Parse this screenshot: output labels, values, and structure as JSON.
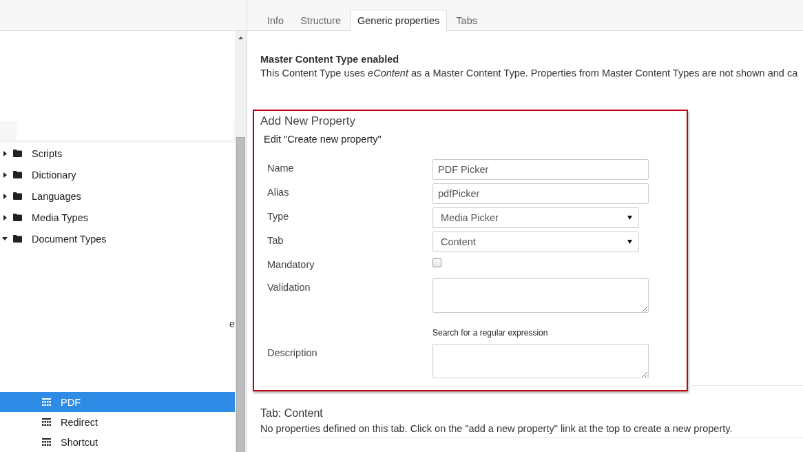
{
  "sidebar": {
    "tree": [
      {
        "label": "Scripts",
        "expanded": false,
        "selected": false
      },
      {
        "label": "Dictionary",
        "expanded": false,
        "selected": false
      },
      {
        "label": "Languages",
        "expanded": false,
        "selected": false
      },
      {
        "label": "Media Types",
        "expanded": false,
        "selected": false
      },
      {
        "label": "Document Types",
        "expanded": true,
        "selected": false,
        "children": [
          {
            "label": "PDF",
            "selected": true
          },
          {
            "label": "Redirect",
            "selected": false
          },
          {
            "label": "Shortcut",
            "selected": false
          }
        ]
      }
    ],
    "partial_label": "e"
  },
  "tabs": [
    {
      "label": "Info",
      "selected": false
    },
    {
      "label": "Structure",
      "selected": false
    },
    {
      "label": "Generic properties",
      "selected": true
    },
    {
      "label": "Tabs",
      "selected": false
    }
  ],
  "notice": {
    "title": "Master Content Type enabled",
    "text": "This Content Type uses *eContent* as a Master Content Type. Properties from Master Content Types are not shown and ca"
  },
  "add_property": {
    "title": "Add New Property",
    "subtitle": "Edit \"Create new property\"",
    "fields": [
      {
        "label": "Name",
        "kind": "text",
        "value": "PDF Picker"
      },
      {
        "label": "Alias",
        "kind": "text",
        "value": "pdfPicker"
      },
      {
        "label": "Type",
        "kind": "select",
        "value": "Media Picker"
      },
      {
        "label": "Tab",
        "kind": "select",
        "value": "Content"
      },
      {
        "label": "Mandatory",
        "kind": "checkbox",
        "checked": false
      },
      {
        "label": "Validation",
        "kind": "textarea",
        "hint": "Search for a regular expression"
      },
      {
        "label": "Description",
        "kind": "textarea"
      }
    ]
  },
  "tab_section": {
    "title": "Tab: Content",
    "text": "No properties defined on this tab. Click on the \"add a new property\" link at the top to create a new property."
  }
}
